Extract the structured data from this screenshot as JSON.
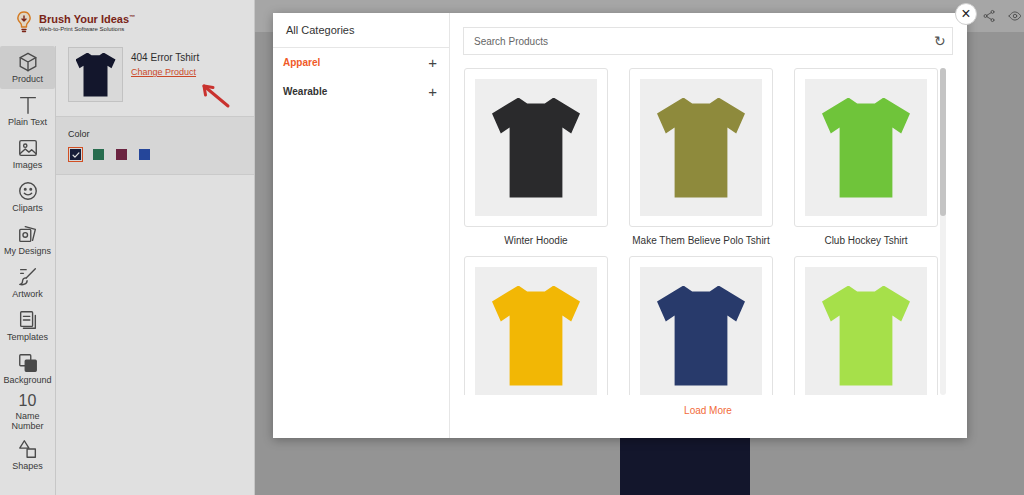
{
  "header": {
    "logo": {
      "name": "Brush Your Ideas",
      "trademark": "™",
      "tagline": "Web-to-Print Software Solutions"
    }
  },
  "toolbar": [
    {
      "label": "Product",
      "selected": true,
      "kind": "product"
    },
    {
      "label": "Plain Text",
      "selected": false,
      "kind": "text"
    },
    {
      "label": "Images",
      "selected": false,
      "kind": "images"
    },
    {
      "label": "Cliparts",
      "selected": false,
      "kind": "cliparts"
    },
    {
      "label": "My Designs",
      "selected": false,
      "kind": "designs"
    },
    {
      "label": "Artwork",
      "selected": false,
      "kind": "artwork"
    },
    {
      "label": "Templates",
      "selected": false,
      "kind": "templates"
    },
    {
      "label": "Background",
      "selected": false,
      "kind": "background"
    },
    {
      "label": "Name Number",
      "selected": false,
      "kind": "number",
      "icon_text": "10"
    },
    {
      "label": "Shapes",
      "selected": false,
      "kind": "shapes"
    }
  ],
  "product_panel": {
    "name": "404 Error Tshirt",
    "change_link": "Change Product",
    "color_label": "Color",
    "swatches": [
      {
        "color": "#1c2140",
        "selected": true
      },
      {
        "color": "#2e7d5b",
        "selected": false
      },
      {
        "color": "#7a2a4a",
        "selected": false
      },
      {
        "color": "#2b50b0",
        "selected": false
      }
    ]
  },
  "modal": {
    "close": "×",
    "categories_header": "All Categories",
    "categories": [
      {
        "label": "Apparel",
        "expand": "+",
        "selected": true
      },
      {
        "label": "Wearable",
        "expand": "+",
        "selected": false
      }
    ],
    "search": {
      "placeholder": "Search Products",
      "refresh": "↻"
    },
    "products": [
      {
        "name": "Winter Hoodie",
        "color": "#2a2a2c"
      },
      {
        "name": "Make Them Believe Polo Tshirt",
        "color": "#8e8a3c"
      },
      {
        "name": "Club Hockey Tshirt",
        "color": "#6fc43a"
      },
      {
        "name": "",
        "color": "#f2b705"
      },
      {
        "name": "",
        "color": "#283a6b"
      },
      {
        "name": "",
        "color": "#a6e04a"
      }
    ],
    "load_more": "Load More"
  }
}
